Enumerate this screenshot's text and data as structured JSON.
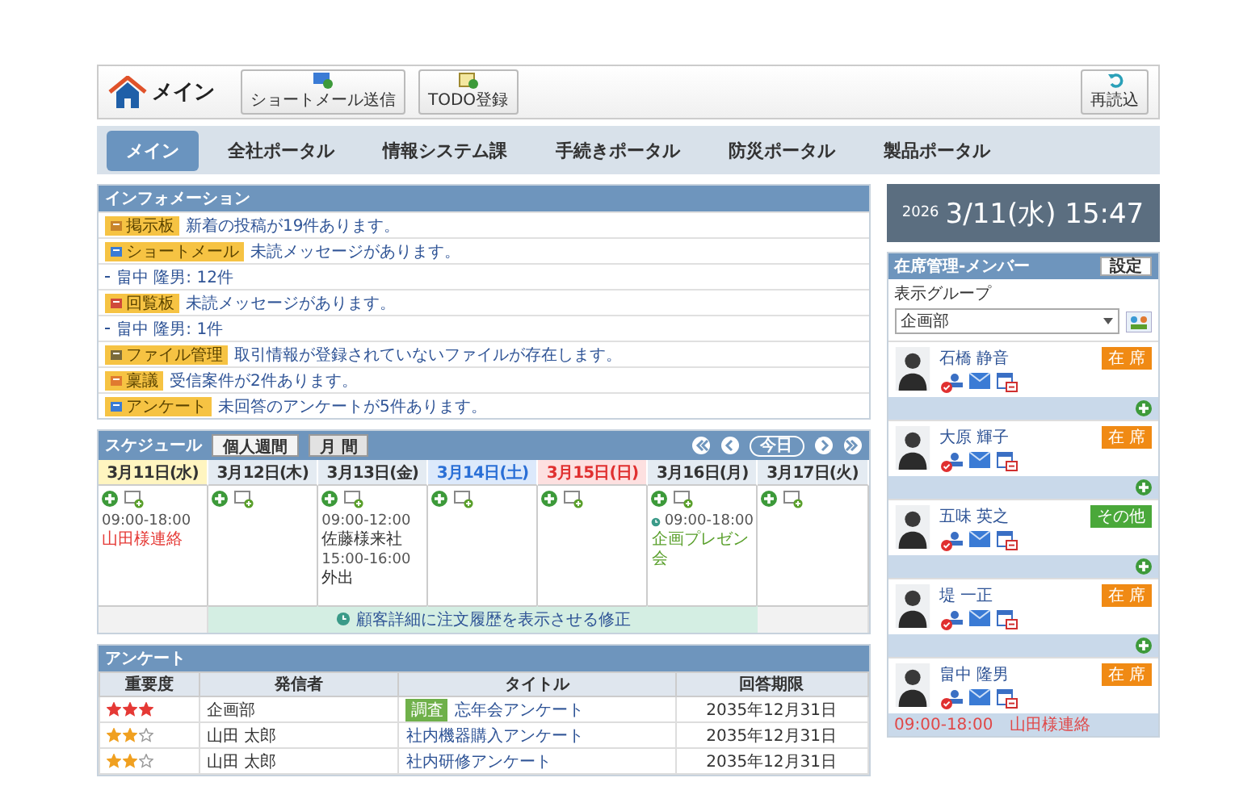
{
  "header": {
    "title": "メイン",
    "buttons": [
      "ショートメール送信",
      "TODO登録"
    ],
    "reload": "再読込"
  },
  "tabs": [
    {
      "label": "メイン",
      "selected": true
    },
    {
      "label": "全社ポータル",
      "selected": false
    },
    {
      "label": "情報システム課",
      "selected": false
    },
    {
      "label": "手続きポータル",
      "selected": false
    },
    {
      "label": "防災ポータル",
      "selected": false
    },
    {
      "label": "製品ポータル",
      "selected": false
    }
  ],
  "information": {
    "title": "インフォメーション",
    "rows": [
      {
        "kind": "notice",
        "badge": "掲示板",
        "text": "新着の投稿が19件あります。"
      },
      {
        "kind": "notice",
        "badge": "ショートメール",
        "text": "未読メッセージがあります。"
      },
      {
        "kind": "detail",
        "text": "畠中 隆男: 12件"
      },
      {
        "kind": "notice",
        "badge": "回覧板",
        "text": "未読メッセージがあります。"
      },
      {
        "kind": "detail",
        "text": "畠中 隆男: 1件"
      },
      {
        "kind": "notice",
        "badge": "ファイル管理",
        "text": "取引情報が登録されていないファイルが存在します。"
      },
      {
        "kind": "notice",
        "badge": "稟議",
        "text": "受信案件が2件あります。"
      },
      {
        "kind": "notice",
        "badge": "アンケート",
        "text": "未回答のアンケートが5件あります。"
      }
    ]
  },
  "schedule": {
    "title": "スケジュール",
    "views": [
      {
        "label": "個人週間",
        "selected": true
      },
      {
        "label": "月 間",
        "selected": false
      }
    ],
    "today": "今日",
    "days": [
      {
        "label": "3月11日(水)",
        "kind": "weekday",
        "selected": true,
        "in_banner": false,
        "events": [
          {
            "time": "09:00-18:00",
            "title": "山田様連絡",
            "color": "#e53935",
            "kind": "plain"
          }
        ]
      },
      {
        "label": "3月12日(木)",
        "kind": "weekday",
        "selected": false,
        "in_banner": true
      },
      {
        "label": "3月13日(金)",
        "kind": "weekday",
        "selected": false,
        "in_banner": true,
        "events": [
          {
            "time": "09:00-12:00",
            "title": "佐藤様来社",
            "color": "#333333",
            "kind": "plain"
          },
          {
            "time": "15:00-16:00",
            "title": "外出",
            "color": "#333333",
            "kind": "plain"
          }
        ]
      },
      {
        "label": "3月14日(土)",
        "kind": "saturday",
        "selected": false,
        "in_banner": true
      },
      {
        "label": "3月15日(日)",
        "kind": "sunday",
        "selected": false,
        "in_banner": true
      },
      {
        "label": "3月16日(月)",
        "kind": "weekday",
        "selected": false,
        "in_banner": true,
        "events": [
          {
            "time": "09:00-18:00",
            "title": "企画プレゼン会",
            "color": "#5aa02c",
            "kind": "shared"
          }
        ]
      },
      {
        "label": "3月17日(火)",
        "kind": "weekday",
        "selected": false,
        "in_banner": false
      }
    ],
    "banner": "顧客詳細に注文履歴を表示させる修正"
  },
  "survey": {
    "title": "アンケート",
    "columns": [
      "重要度",
      "発信者",
      "タイトル",
      "回答期限"
    ],
    "rows": [
      {
        "stars": 3,
        "sender": "企画部",
        "tag": "調査",
        "title": "忘年会アンケート",
        "deadline": "2035年12月31日"
      },
      {
        "stars": 2,
        "sender": "山田 太郎",
        "title": "社内機器購入アンケート",
        "deadline": "2035年12月31日"
      },
      {
        "stars": 2,
        "sender": "山田 太郎",
        "title": "社内研修アンケート",
        "deadline": "2035年12月31日"
      }
    ]
  },
  "clock": {
    "year": "2026",
    "datetime": "3/11(水) 15:47"
  },
  "members": {
    "title": "在席管理-メンバー",
    "settings": "設定",
    "group_label": "表示グループ",
    "group": "企画部",
    "items": [
      {
        "name": "石橋 静音",
        "status": "在 席",
        "color": "#f08a14"
      },
      {
        "name": "大原 輝子",
        "status": "在 席",
        "color": "#f08a14"
      },
      {
        "name": "五味 英之",
        "status": "その他",
        "color": "#4aa83a"
      },
      {
        "name": "堤 一正",
        "status": "在 席",
        "color": "#f08a14"
      },
      {
        "name": "畠中 隆男",
        "status": "在 席",
        "color": "#f08a14",
        "schedule": {
          "time": "09:00-18:00",
          "title": "山田様連絡"
        }
      }
    ]
  }
}
